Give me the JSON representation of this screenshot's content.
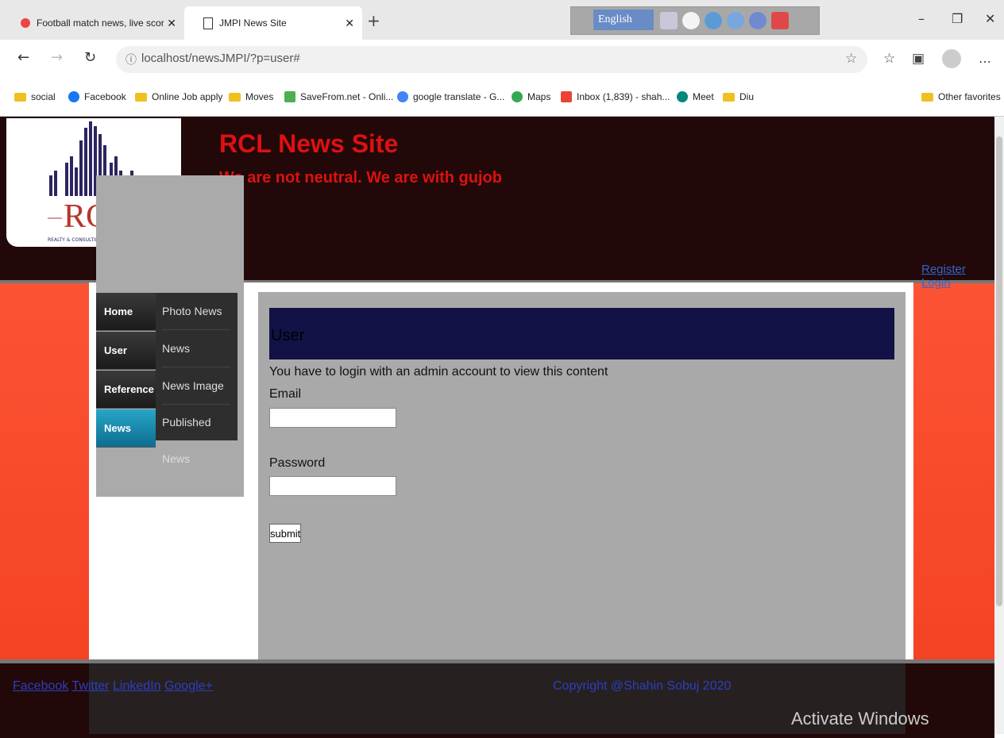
{
  "tabs": [
    {
      "title": "Football match news, live score ("
    },
    {
      "title": "JMPI News Site"
    }
  ],
  "new_tab_icon": "plus-icon",
  "toolbar_language": "English",
  "window_buttons": [
    "minimize-icon",
    "restore-icon",
    "close-icon"
  ],
  "address": {
    "url": "localhost/newsJMPI/?p=user#"
  },
  "bookmarks": [
    {
      "label": "social",
      "icon": "folder"
    },
    {
      "label": "Facebook",
      "icon": "facebook"
    },
    {
      "label": "Online Job apply",
      "icon": "folder"
    },
    {
      "label": "Moves",
      "icon": "folder"
    },
    {
      "label": "SaveFrom.net - Onli...",
      "icon": "download"
    },
    {
      "label": "google translate - G...",
      "icon": "google"
    },
    {
      "label": "Maps",
      "icon": "maps"
    },
    {
      "label": "Inbox (1,839) - shah...",
      "icon": "gmail"
    },
    {
      "label": "Meet",
      "icon": "meet"
    },
    {
      "label": "Diu",
      "icon": "folder"
    }
  ],
  "other_favorites": "Other favorites",
  "site": {
    "logo_text": "RCL",
    "logo_sub": "REALTY & CONSULTING SERVICES",
    "title": "RCL News Site",
    "tagline": "We are not neutral. We are with gujob",
    "register": "Register",
    "login": "Login"
  },
  "nav": [
    {
      "label": "Home"
    },
    {
      "label": "User"
    },
    {
      "label": "Reference"
    },
    {
      "label": "News"
    }
  ],
  "submenu": [
    {
      "label": "Photo News"
    },
    {
      "label": "News"
    },
    {
      "label": "News Image"
    },
    {
      "label": "Published News"
    }
  ],
  "main": {
    "heading": "User",
    "message": "You have to login with an admin account to view this content",
    "email_label": "Email",
    "password_label": "Password",
    "submit_label": "submit"
  },
  "footer": {
    "links": [
      "Facebook",
      "Twitter",
      "LinkedIn",
      "Google+"
    ],
    "copyright": "Copyright @Shahin Sobuj 2020"
  },
  "watermark": "Activate Windows",
  "colors": {
    "header_bg": "#220808",
    "title_red": "#dd1111",
    "page_red": "#f34020",
    "nav_active": "#0d6e8f"
  }
}
